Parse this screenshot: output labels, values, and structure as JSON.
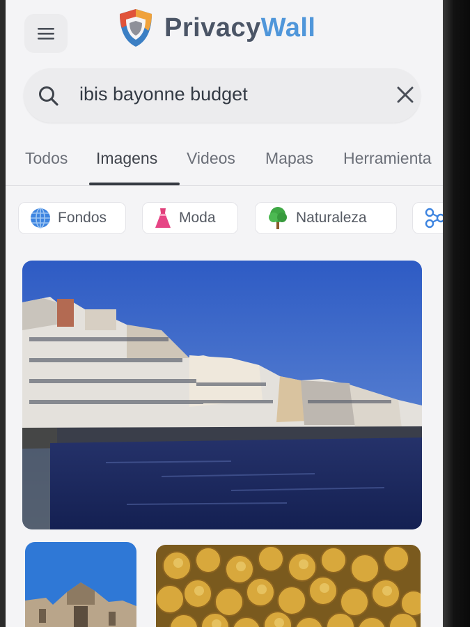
{
  "app": {
    "brand_part1": "Privacy",
    "brand_part2": "Wall"
  },
  "search": {
    "query": "ibis bayonne budget"
  },
  "tabs": [
    {
      "label": "Todos",
      "active": false
    },
    {
      "label": "Imagens",
      "active": true
    },
    {
      "label": "Videos",
      "active": false
    },
    {
      "label": "Mapas",
      "active": false
    },
    {
      "label": "Herramienta",
      "active": false
    }
  ],
  "chips": [
    {
      "label": "Fondos",
      "icon": "globe-icon"
    },
    {
      "label": "Moda",
      "icon": "dress-icon"
    },
    {
      "label": "Naturaleza",
      "icon": "tree-icon"
    },
    {
      "label": "",
      "icon": "network-icon"
    }
  ],
  "results": [
    {
      "subject": "bayonne-riverfront",
      "icon": "image"
    },
    {
      "subject": "cathedral",
      "icon": "image"
    },
    {
      "subject": "gold-coins",
      "icon": "image"
    }
  ],
  "colors": {
    "brand_blue": "#4f96da",
    "brand_gray": "#4b5566",
    "shield_red": "#e0533a",
    "shield_orange": "#f0a23b",
    "shield_blue": "#3b7fc4"
  }
}
